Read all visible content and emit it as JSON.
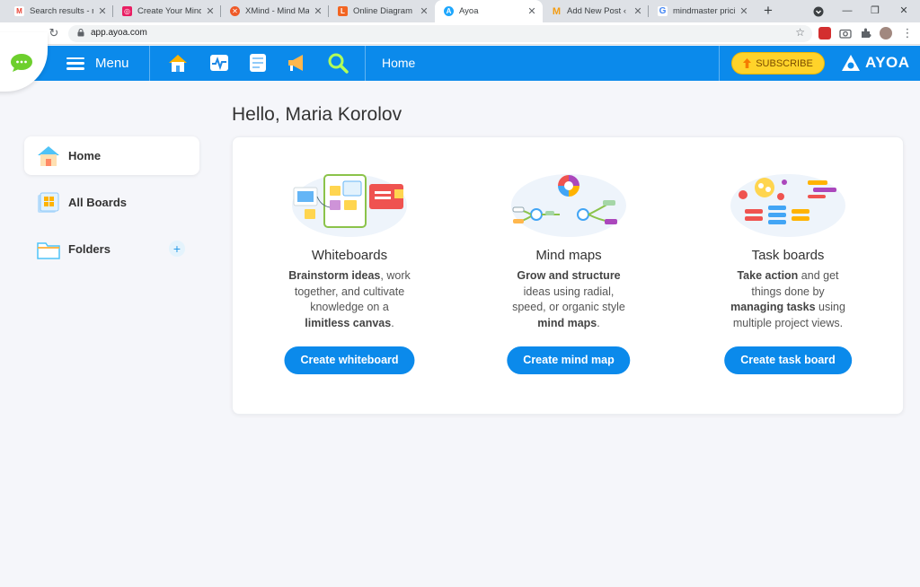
{
  "browser": {
    "tabs": [
      {
        "title": "Search results - mail",
        "favicon": "gmail-icon",
        "color": "#ea4335",
        "active": false
      },
      {
        "title": "Create Your Mind Maps",
        "favicon": "mindmap-site-icon",
        "color": "#e91e63",
        "active": false
      },
      {
        "title": "XMind - Mind Mapping",
        "favicon": "xmind-icon",
        "color": "#ef5a28",
        "active": false
      },
      {
        "title": "Online Diagram Software",
        "favicon": "lucid-icon",
        "color": "#f26522",
        "active": false
      },
      {
        "title": "Ayoa",
        "favicon": "ayoa-icon",
        "color": "#1ea7fd",
        "active": true
      },
      {
        "title": "Add New Post ‹ Media",
        "favicon": "m-icon",
        "color": "#f39c12",
        "active": false
      },
      {
        "title": "mindmaster pricing",
        "favicon": "google-icon",
        "color": "#4285f4",
        "active": false
      }
    ],
    "url": "app.ayoa.com"
  },
  "header": {
    "menu_label": "Menu",
    "breadcrumb": "Home",
    "subscribe_label": "SUBSCRIBE",
    "brand": "AYOA",
    "nav_icons": [
      "home-icon",
      "activity-icon",
      "notes-icon",
      "megaphone-icon",
      "search-icon"
    ]
  },
  "sidebar": {
    "items": [
      {
        "label": "Home",
        "icon": "home-icon",
        "active": true
      },
      {
        "label": "All Boards",
        "icon": "boards-icon",
        "active": false
      },
      {
        "label": "Folders",
        "icon": "folder-icon",
        "active": false
      }
    ]
  },
  "main": {
    "greeting": "Hello, Maria Korolov",
    "cards": [
      {
        "title": "Whiteboards",
        "desc": [
          {
            "t": "Brainstorm ideas",
            "b": true
          },
          {
            "t": ", work together, and cultivate knowledge on a ",
            "b": false
          },
          {
            "t": "limitless canvas",
            "b": true
          },
          {
            "t": ".",
            "b": false
          }
        ],
        "button": "Create whiteboard"
      },
      {
        "title": "Mind maps",
        "desc": [
          {
            "t": "Grow and structure",
            "b": true
          },
          {
            "t": " ideas using radial, speed, or organic style ",
            "b": false
          },
          {
            "t": "mind maps",
            "b": true
          },
          {
            "t": ".",
            "b": false
          }
        ],
        "button": "Create mind map"
      },
      {
        "title": "Task boards",
        "desc": [
          {
            "t": "Take action",
            "b": true
          },
          {
            "t": " and get things done by ",
            "b": false
          },
          {
            "t": "managing tasks",
            "b": true
          },
          {
            "t": " using multiple project views.",
            "b": false
          }
        ],
        "button": "Create task board"
      }
    ]
  },
  "colors": {
    "brand_blue": "#0b8aeb",
    "subscribe_yellow": "#ffd32a",
    "background": "#f5f6fa"
  }
}
